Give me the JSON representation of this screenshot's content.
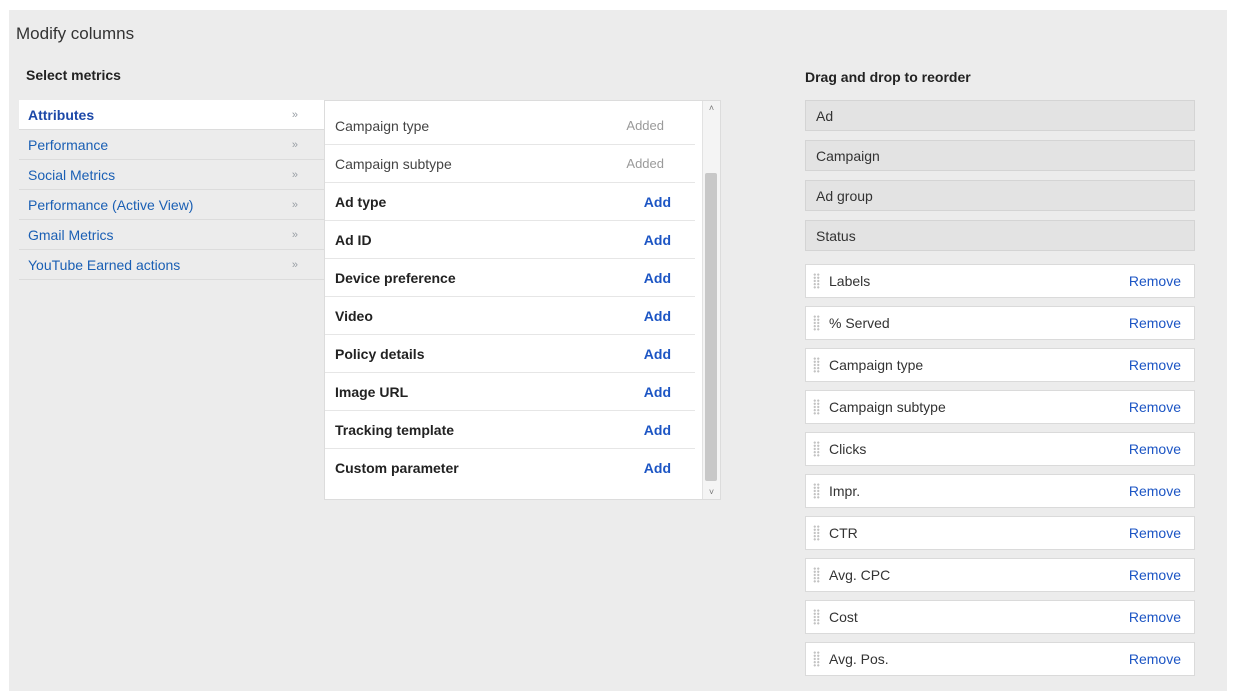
{
  "title": "Modify columns",
  "select_metrics_heading": "Select metrics",
  "reorder_heading": "Drag and drop to reorder",
  "categories": [
    {
      "label": "Attributes",
      "chevron": "»",
      "active": true
    },
    {
      "label": "Performance",
      "chevron": "»"
    },
    {
      "label": "Social Metrics",
      "chevron": "»"
    },
    {
      "label": "Performance (Active View)",
      "chevron": "»"
    },
    {
      "label": "Gmail Metrics",
      "chevron": "»"
    },
    {
      "label": "YouTube Earned actions",
      "chevron": "»"
    }
  ],
  "metrics": [
    {
      "name": "Campaign type",
      "action": "Added",
      "added": true
    },
    {
      "name": "Campaign subtype",
      "action": "Added",
      "added": true
    },
    {
      "name": "Ad type",
      "action": "Add"
    },
    {
      "name": "Ad ID",
      "action": "Add"
    },
    {
      "name": "Device preference",
      "action": "Add"
    },
    {
      "name": "Video",
      "action": "Add"
    },
    {
      "name": "Policy details",
      "action": "Add"
    },
    {
      "name": "Image URL",
      "action": "Add"
    },
    {
      "name": "Tracking template",
      "action": "Add"
    },
    {
      "name": "Custom parameter",
      "action": "Add"
    }
  ],
  "scroll_up": "˄",
  "scroll_down": "˅",
  "fixed_columns": [
    "Ad",
    "Campaign",
    "Ad group",
    "Status"
  ],
  "remove_label": "Remove",
  "draggable_columns": [
    "Labels",
    "% Served",
    "Campaign type",
    "Campaign subtype",
    "Clicks",
    "Impr.",
    "CTR",
    "Avg. CPC",
    "Cost",
    "Avg. Pos."
  ],
  "colors": {
    "link": "#1c55c4",
    "category_link": "#1a5fb4",
    "panel_bg": "#ececec"
  }
}
